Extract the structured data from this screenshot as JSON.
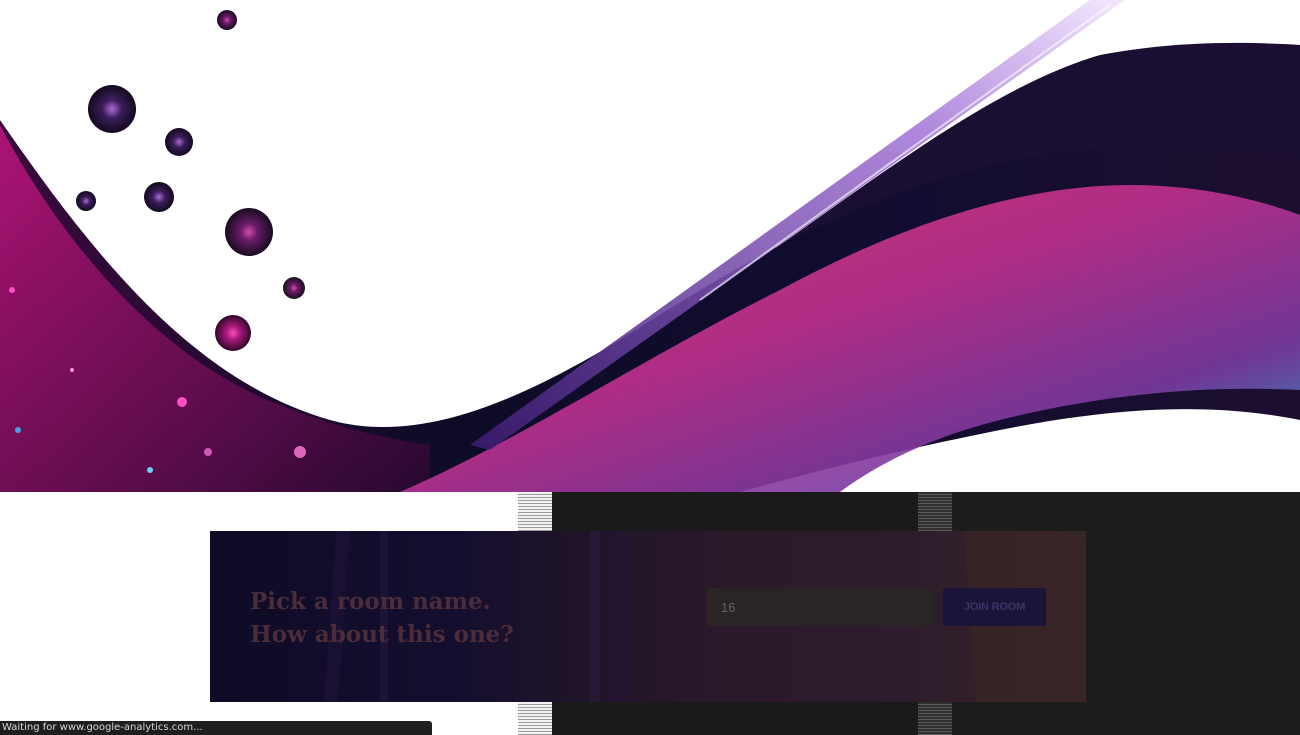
{
  "hero": {
    "image_name": "abstract-purple-wave-artwork",
    "colors": {
      "magenta": "#d22a9e",
      "violet": "#5a1f7a",
      "cyan": "#2aa9d8",
      "navy": "#0d0a2a",
      "pink": "#e0417a"
    }
  },
  "room": {
    "heading_line1": "Pick a room name.",
    "heading_line2": "How about this one?",
    "input_value": "16",
    "join_label": "JOIN ROOM"
  },
  "status": {
    "text": "Waiting for www.google-analytics.com..."
  }
}
